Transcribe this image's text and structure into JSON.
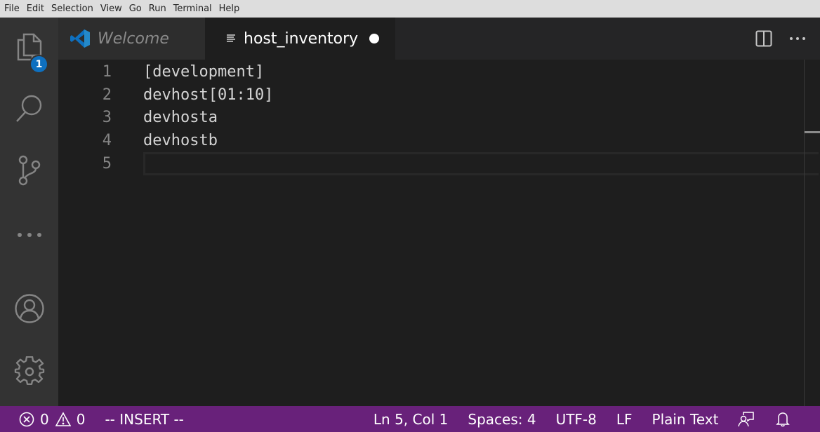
{
  "menubar": {
    "items": [
      "File",
      "Edit",
      "Selection",
      "View",
      "Go",
      "Run",
      "Terminal",
      "Help"
    ]
  },
  "activitybar": {
    "items": [
      {
        "name": "explorer",
        "icon": "files-icon",
        "badge": "1"
      },
      {
        "name": "search",
        "icon": "search-icon"
      },
      {
        "name": "source-control",
        "icon": "source-control-icon"
      },
      {
        "name": "more",
        "icon": "ellipsis-icon"
      }
    ],
    "bottom": [
      {
        "name": "accounts",
        "icon": "account-icon"
      },
      {
        "name": "manage",
        "icon": "gear-icon"
      }
    ]
  },
  "tabs": [
    {
      "label": "Welcome",
      "icon": "vscode-logo-icon",
      "active": false,
      "preview": true
    },
    {
      "label": "host_inventory",
      "icon": "plaintext-file-icon",
      "active": true,
      "dirty": true
    }
  ],
  "tab_actions": {
    "split": "split-editor-icon",
    "more": "more-actions-icon"
  },
  "editor": {
    "lines": [
      {
        "number": "1",
        "text": "[development]"
      },
      {
        "number": "2",
        "text": "devhost[01:10]"
      },
      {
        "number": "3",
        "text": "devhosta"
      },
      {
        "number": "4",
        "text": "devhostb"
      },
      {
        "number": "5",
        "text": ""
      }
    ],
    "current_line": 5
  },
  "statusbar": {
    "errors": "0",
    "warnings": "0",
    "mode": "-- INSERT --",
    "position": "Ln 5, Col 1",
    "indent": "Spaces: 4",
    "encoding": "UTF-8",
    "eol": "LF",
    "language": "Plain Text",
    "background": "#68217a"
  },
  "colors": {
    "accent": "#0e70c0",
    "badge": "#0e70c0",
    "statusbar": "#68217a"
  }
}
